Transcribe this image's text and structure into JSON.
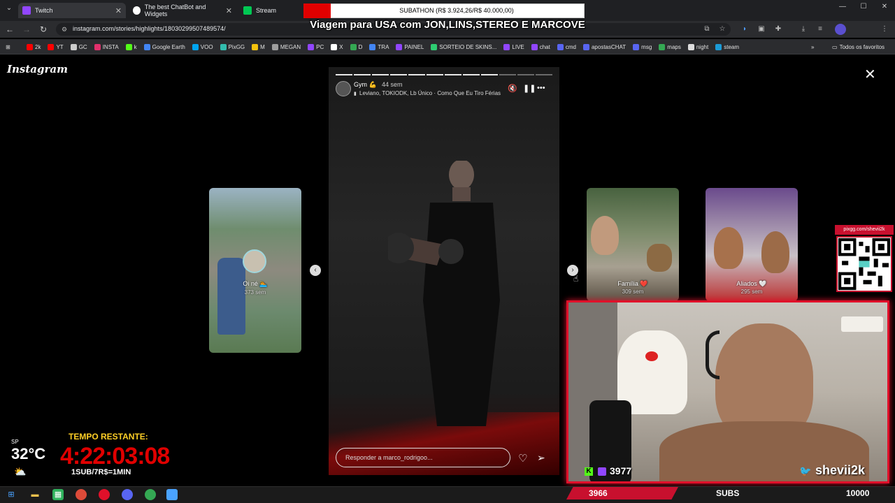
{
  "tabs": [
    {
      "label": "Twitch",
      "color": "#9146ff"
    },
    {
      "label": "The best ChatBot and Widgets",
      "color": "#ffffff"
    },
    {
      "label": "Stream",
      "color": "#00c853"
    }
  ],
  "address": {
    "url": "instagram.com/stories/highlights/18030299507489574/"
  },
  "bookmarks": [
    {
      "label": "2k",
      "color": "#ff0000"
    },
    {
      "label": "YT",
      "color": "#ff0000"
    },
    {
      "label": "GC",
      "color": "#cccccc"
    },
    {
      "label": "INSTA",
      "color": "#e1306c"
    },
    {
      "label": "k",
      "color": "#53fc18"
    },
    {
      "label": "Google Earth",
      "color": "#4285f4"
    },
    {
      "label": "VOO",
      "color": "#00a4ef"
    },
    {
      "label": "PixGG",
      "color": "#32bcad"
    },
    {
      "label": "M",
      "color": "#f4c20d"
    },
    {
      "label": "MEGAN",
      "color": "#9e9e9e"
    },
    {
      "label": "PC",
      "color": "#9146ff"
    },
    {
      "label": "X",
      "color": "#ffffff"
    },
    {
      "label": "D",
      "color": "#34a853"
    },
    {
      "label": "TRA",
      "color": "#4285f4"
    },
    {
      "label": "PAINEL",
      "color": "#9146ff"
    },
    {
      "label": "SORTEIO DE SKINS...",
      "color": "#2ecc71"
    },
    {
      "label": "LIVE",
      "color": "#9146ff"
    },
    {
      "label": "chat",
      "color": "#9146ff"
    },
    {
      "label": "cmd",
      "color": "#5865f2"
    },
    {
      "label": "apostasCHAT",
      "color": "#5865f2"
    },
    {
      "label": "msg",
      "color": "#5865f2"
    },
    {
      "label": "maps",
      "color": "#34a853"
    },
    {
      "label": "night",
      "color": "#dddddd"
    },
    {
      "label": "steam",
      "color": "#1b9bd7"
    }
  ],
  "bookmarks_folder": "Todos os favoritos",
  "overlay": {
    "subathon": "SUBATHON (R$ 3.924,26/R$ 40.000,00)",
    "subathon_progress": 0.098,
    "trip": "Viagem para USA com JON,LINS,STEREO E MARCOVE"
  },
  "instagram": {
    "logo": "Instagram",
    "close": "✕",
    "story": {
      "name": "Gym 💪",
      "time": "44 sem",
      "music": "Leviano, TOKIODK, Lb Único · Como Que Eu Tiro Férias",
      "reply_placeholder": "Responder a marco_rodrigoo...",
      "progress_total": 12,
      "progress_done": 9
    },
    "side_cards": [
      {
        "label": "Oi né 🏊",
        "time": "373 sem"
      },
      {
        "label": "Família ❤️",
        "time": "309 sem"
      },
      {
        "label": "Aliados 🤍",
        "time": "295 sem"
      }
    ]
  },
  "qr": {
    "header": "pixgg.com/shevii2k"
  },
  "webcam": {
    "kick_count": "3977",
    "twitter_handle": "shevii2k"
  },
  "widget": {
    "region": "SP",
    "temperature": "32°C",
    "timer_label": "TEMPO RESTANTE:",
    "timer": "4:22:03:08",
    "rule": "1SUB/7R$=1MIN"
  },
  "subs": {
    "count": "3966",
    "label": "SUBS",
    "goal": "10000"
  }
}
